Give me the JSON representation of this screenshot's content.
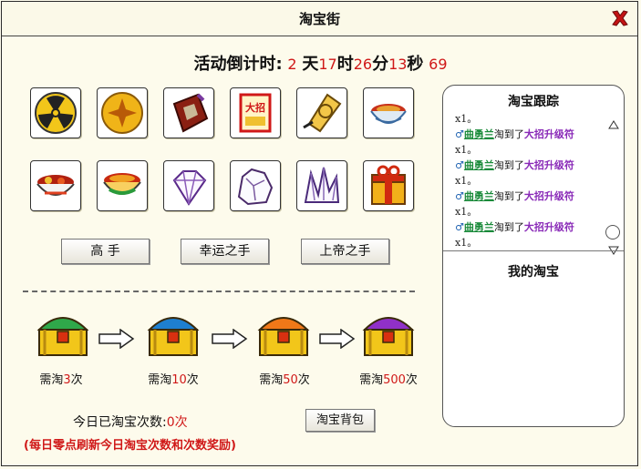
{
  "window": {
    "title": "淘宝街"
  },
  "countdown": {
    "label": "活动倒计时:",
    "days": "2",
    "days_unit": "天",
    "hours": "17",
    "hours_unit": "时",
    "minutes": "26",
    "minutes_unit": "分",
    "seconds": "13",
    "seconds_unit": "秒",
    "extra": "69"
  },
  "items": [
    {
      "icon": "radiation-token-icon"
    },
    {
      "icon": "gold-star-coin-icon"
    },
    {
      "icon": "red-talisman-bag-icon"
    },
    {
      "icon": "big-move-scroll-icon"
    },
    {
      "icon": "gold-badge-icon"
    },
    {
      "icon": "soup-bowl-icon"
    },
    {
      "icon": "fruit-bowl-icon"
    },
    {
      "icon": "red-soup-bowl-icon"
    },
    {
      "icon": "crystal-diamond-icon"
    },
    {
      "icon": "crystal-ore-icon"
    },
    {
      "icon": "crystal-cluster-icon"
    },
    {
      "icon": "gift-box-icon"
    }
  ],
  "big_move_text": "大招",
  "buttons": {
    "expert": "高  手",
    "lucky": "幸运之手",
    "god": "上帝之手"
  },
  "chests": [
    {
      "prefix": "需淘",
      "count": "3",
      "suffix": "次",
      "color": "#2fa84a"
    },
    {
      "prefix": "需淘",
      "count": "10",
      "suffix": "次",
      "color": "#1e7fd0"
    },
    {
      "prefix": "需淘",
      "count": "50",
      "suffix": "次",
      "color": "#f07818"
    },
    {
      "prefix": "需淘",
      "count": "500",
      "suffix": "次",
      "color": "#9030c8"
    }
  ],
  "today": {
    "label": "今日已淘宝次数:",
    "count": "0",
    "unit": "次"
  },
  "bag_button": "淘宝背包",
  "notice": "(每日零点刷新今日淘宝次数和次数奖励)",
  "tracking": {
    "title": "淘宝跟踪",
    "top_suffix": "x1。",
    "entries": [
      {
        "gender": "♂",
        "name": "曲勇兰",
        "verb": "淘到了",
        "item": "大招升级符",
        "suffix": "x1。"
      },
      {
        "gender": "♂",
        "name": "曲勇兰",
        "verb": "淘到了",
        "item": "大招升级符",
        "suffix": "x1。"
      },
      {
        "gender": "♂",
        "name": "曲勇兰",
        "verb": "淘到了",
        "item": "大招升级符",
        "suffix": "x1。"
      },
      {
        "gender": "♂",
        "name": "曲勇兰",
        "verb": "淘到了",
        "item": "大招升级符",
        "suffix": "x1。"
      }
    ]
  },
  "my_treasure": {
    "title": "我的淘宝"
  },
  "colors": {
    "accent_red": "#d01818",
    "name_green": "#1a8a3a",
    "item_purple": "#8a2bb8"
  }
}
